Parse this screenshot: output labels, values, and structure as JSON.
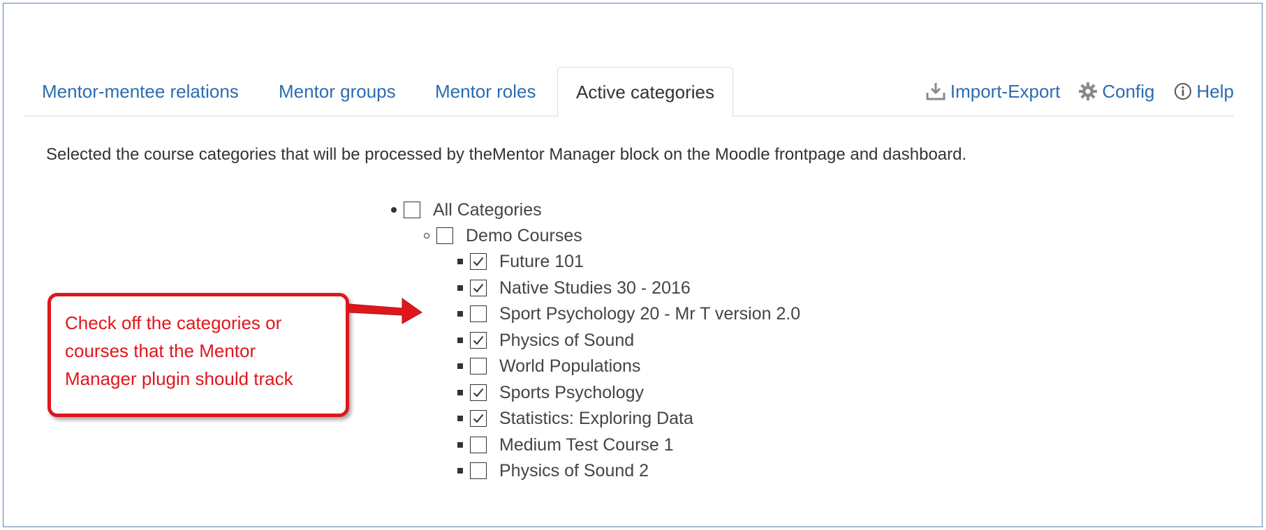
{
  "tabs": [
    {
      "label": "Mentor-mentee relations",
      "active": false
    },
    {
      "label": "Mentor groups",
      "active": false
    },
    {
      "label": "Mentor roles",
      "active": false
    },
    {
      "label": "Active categories",
      "active": true
    }
  ],
  "links": {
    "import_export": "Import-Export",
    "config": "Config",
    "help": "Help"
  },
  "description": "Selected the course categories that will be processed by theMentor Manager block on the Moodle frontpage and dashboard.",
  "tree": {
    "root": {
      "label": "All Categories",
      "checked": false
    },
    "category": {
      "label": "Demo Courses",
      "checked": false
    },
    "courses": [
      {
        "label": "Future 101",
        "checked": true
      },
      {
        "label": "Native Studies 30 - 2016",
        "checked": true
      },
      {
        "label": "Sport Psychology 20 - Mr T version 2.0",
        "checked": false
      },
      {
        "label": "Physics of Sound",
        "checked": true
      },
      {
        "label": "World Populations",
        "checked": false
      },
      {
        "label": "Sports Psychology",
        "checked": true
      },
      {
        "label": "Statistics: Exploring Data",
        "checked": true
      },
      {
        "label": "Medium Test Course 1",
        "checked": false
      },
      {
        "label": "Physics of Sound 2",
        "checked": false
      }
    ]
  },
  "callout": {
    "text": "Check off the categories or courses that the Mentor Manager plugin should track",
    "color": "#e0161d"
  },
  "colors": {
    "link": "#2b6cb0",
    "frame": "#5b7fb4"
  }
}
